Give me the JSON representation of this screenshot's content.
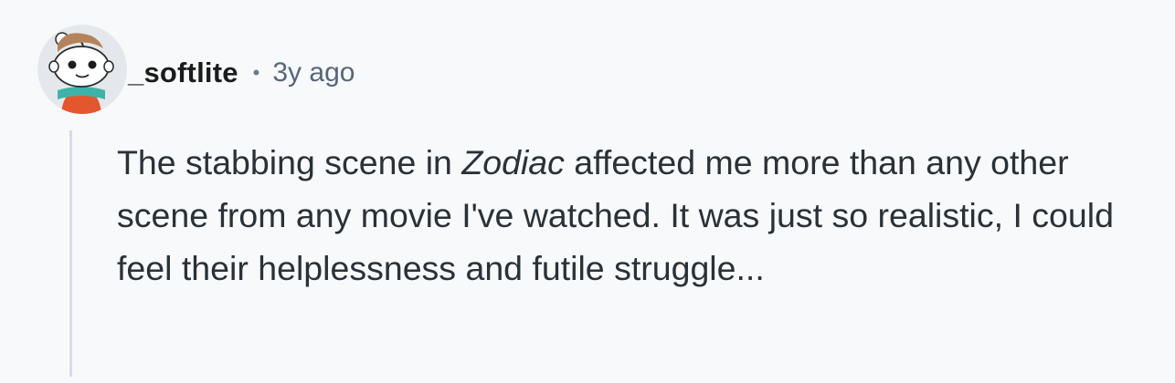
{
  "comment": {
    "author": "_softlite",
    "separator": "•",
    "timestamp": "3y ago",
    "avatar_icon": "snoo-avatar-icon",
    "body": {
      "before_italic": "The stabbing scene in ",
      "italic": "Zodiac",
      "after_italic": " affected me more than any other scene from any movie I've watched. It was just so realistic, I could feel their helplessness and futile struggle..."
    }
  },
  "colors": {
    "background": "#f7f9fb",
    "author_text": "#1c1c1c",
    "meta_text": "#56677a",
    "body_text": "#2a3137",
    "thread_line": "#d6dde5",
    "avatar_shirt": "#e4572e",
    "avatar_scarf": "#3fb3a8"
  }
}
